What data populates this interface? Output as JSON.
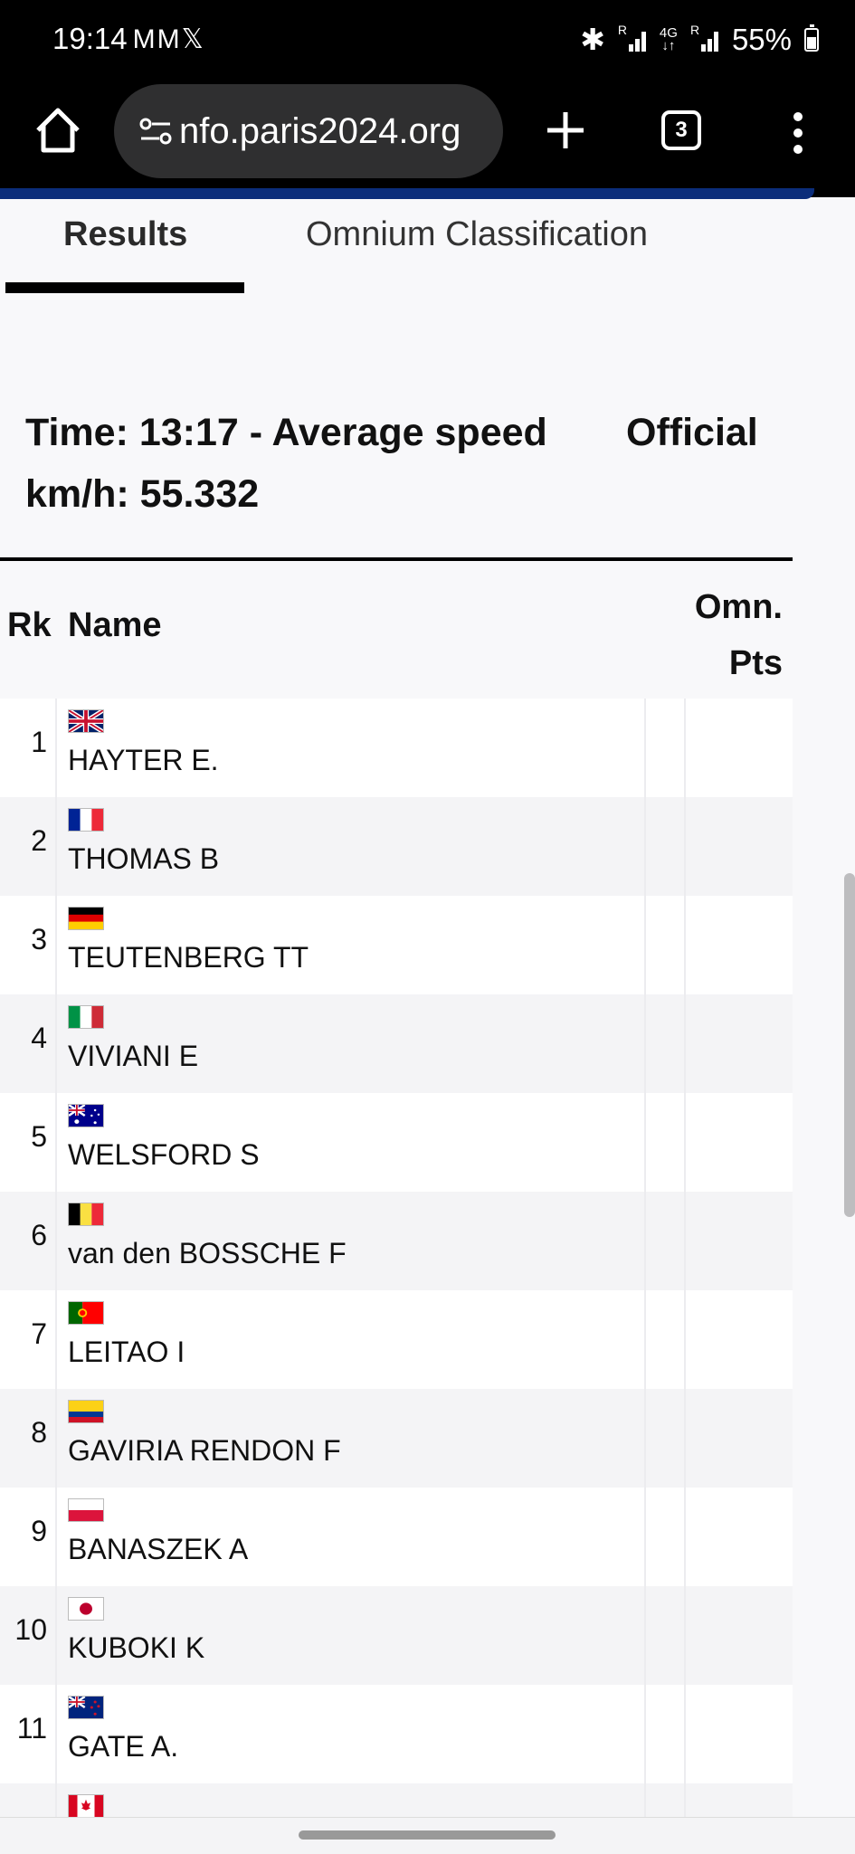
{
  "status_bar": {
    "time": "19:14",
    "notification_icons": "MM𝕏",
    "network_4g": "4G",
    "battery": "55%"
  },
  "browser": {
    "url": "nfo.paris2024.org",
    "tab_count": "3"
  },
  "page": {
    "tabs": [
      {
        "label": "Results",
        "active": true
      },
      {
        "label": "Omnium Classification",
        "active": false
      }
    ],
    "event_info": "Time: 13:17 - Average speed km/h: 55.332",
    "status": "Official",
    "columns": {
      "rank": "Rk",
      "name": "Name",
      "points_line1": "Omn.",
      "points_line2": "Pts"
    },
    "rows": [
      {
        "rank": "1",
        "name": "HAYTER E.",
        "flag": "gb-flag-icon"
      },
      {
        "rank": "2",
        "name": "THOMAS B",
        "flag": "fr-flag-icon"
      },
      {
        "rank": "3",
        "name": "TEUTENBERG TT",
        "flag": "de-flag-icon"
      },
      {
        "rank": "4",
        "name": "VIVIANI E",
        "flag": "it-flag-icon"
      },
      {
        "rank": "5",
        "name": "WELSFORD S",
        "flag": "au-flag-icon"
      },
      {
        "rank": "6",
        "name": "van den BOSSCHE F",
        "flag": "be-flag-icon"
      },
      {
        "rank": "7",
        "name": "LEITAO I",
        "flag": "pt-flag-icon"
      },
      {
        "rank": "8",
        "name": "GAVIRIA RENDON F",
        "flag": "co-flag-icon"
      },
      {
        "rank": "9",
        "name": "BANASZEK A",
        "flag": "pl-flag-icon"
      },
      {
        "rank": "10",
        "name": "KUBOKI K",
        "flag": "jp-flag-icon"
      },
      {
        "rank": "11",
        "name": "GATE A.",
        "flag": "nz-flag-icon"
      },
      {
        "rank": "",
        "name": "",
        "flag": "ca-flag-icon"
      }
    ]
  }
}
